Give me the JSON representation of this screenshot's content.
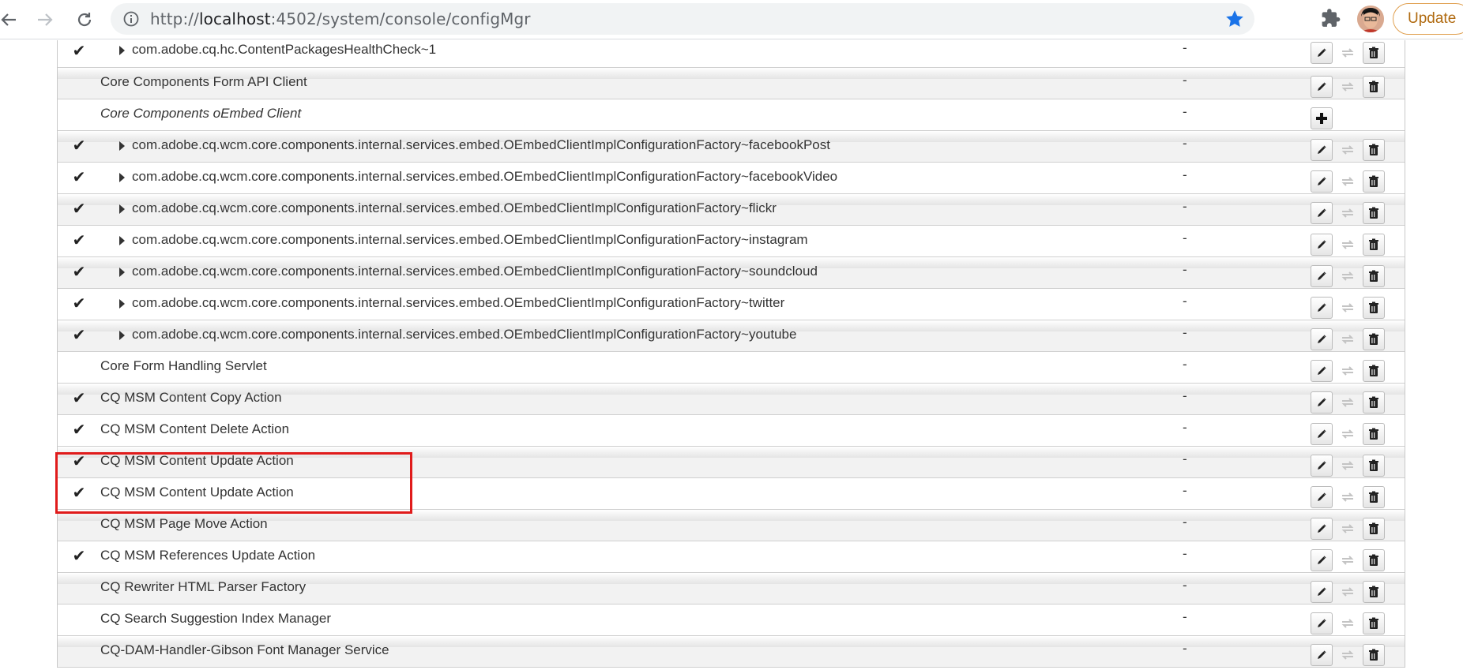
{
  "browser": {
    "url_prefix": "http://",
    "url_host": "localhost",
    "url_rest": ":4502/system/console/configMgr",
    "update_label": "Update"
  },
  "config": {
    "rows": [
      {
        "name": "com.adobe.cq.hc.ContentPackagesHealthCheck~1",
        "checked": true,
        "child": true,
        "dash": "-",
        "actions": "full"
      },
      {
        "name": "Core Components Form API Client",
        "checked": false,
        "child": false,
        "dash": "-",
        "actions": "full"
      },
      {
        "name": "Core Components oEmbed Client",
        "checked": false,
        "child": false,
        "italic": true,
        "dash": "-",
        "actions": "add"
      },
      {
        "name": "com.adobe.cq.wcm.core.components.internal.services.embed.OEmbedClientImplConfigurationFactory~facebookPost",
        "checked": true,
        "child": true,
        "dash": "-",
        "actions": "full"
      },
      {
        "name": "com.adobe.cq.wcm.core.components.internal.services.embed.OEmbedClientImplConfigurationFactory~facebookVideo",
        "checked": true,
        "child": true,
        "dash": "-",
        "actions": "full"
      },
      {
        "name": "com.adobe.cq.wcm.core.components.internal.services.embed.OEmbedClientImplConfigurationFactory~flickr",
        "checked": true,
        "child": true,
        "dash": "-",
        "actions": "full"
      },
      {
        "name": "com.adobe.cq.wcm.core.components.internal.services.embed.OEmbedClientImplConfigurationFactory~instagram",
        "checked": true,
        "child": true,
        "dash": "-",
        "actions": "full"
      },
      {
        "name": "com.adobe.cq.wcm.core.components.internal.services.embed.OEmbedClientImplConfigurationFactory~soundcloud",
        "checked": true,
        "child": true,
        "dash": "-",
        "actions": "full"
      },
      {
        "name": "com.adobe.cq.wcm.core.components.internal.services.embed.OEmbedClientImplConfigurationFactory~twitter",
        "checked": true,
        "child": true,
        "dash": "-",
        "actions": "full"
      },
      {
        "name": "com.adobe.cq.wcm.core.components.internal.services.embed.OEmbedClientImplConfigurationFactory~youtube",
        "checked": true,
        "child": true,
        "dash": "-",
        "actions": "full"
      },
      {
        "name": "Core Form Handling Servlet",
        "checked": false,
        "child": false,
        "dash": "-",
        "actions": "full"
      },
      {
        "name": "CQ MSM Content Copy Action",
        "checked": true,
        "child": false,
        "dash": "-",
        "actions": "full"
      },
      {
        "name": "CQ MSM Content Delete Action",
        "checked": true,
        "child": false,
        "dash": "-",
        "actions": "full"
      },
      {
        "name": "CQ MSM Content Update Action",
        "checked": true,
        "child": false,
        "dash": "-",
        "actions": "full"
      },
      {
        "name": "CQ MSM Content Update Action",
        "checked": true,
        "child": false,
        "dash": "-",
        "actions": "full"
      },
      {
        "name": "CQ MSM Page Move Action",
        "checked": false,
        "child": false,
        "dash": "-",
        "actions": "full"
      },
      {
        "name": "CQ MSM References Update Action",
        "checked": true,
        "child": false,
        "dash": "-",
        "actions": "full"
      },
      {
        "name": "CQ Rewriter HTML Parser Factory",
        "checked": false,
        "child": false,
        "dash": "-",
        "actions": "full"
      },
      {
        "name": "CQ Search Suggestion Index Manager",
        "checked": false,
        "child": false,
        "dash": "-",
        "actions": "full"
      },
      {
        "name": "CQ-DAM-Handler-Gibson Font Manager Service",
        "checked": false,
        "child": false,
        "dash": "-",
        "actions": "full"
      }
    ]
  }
}
